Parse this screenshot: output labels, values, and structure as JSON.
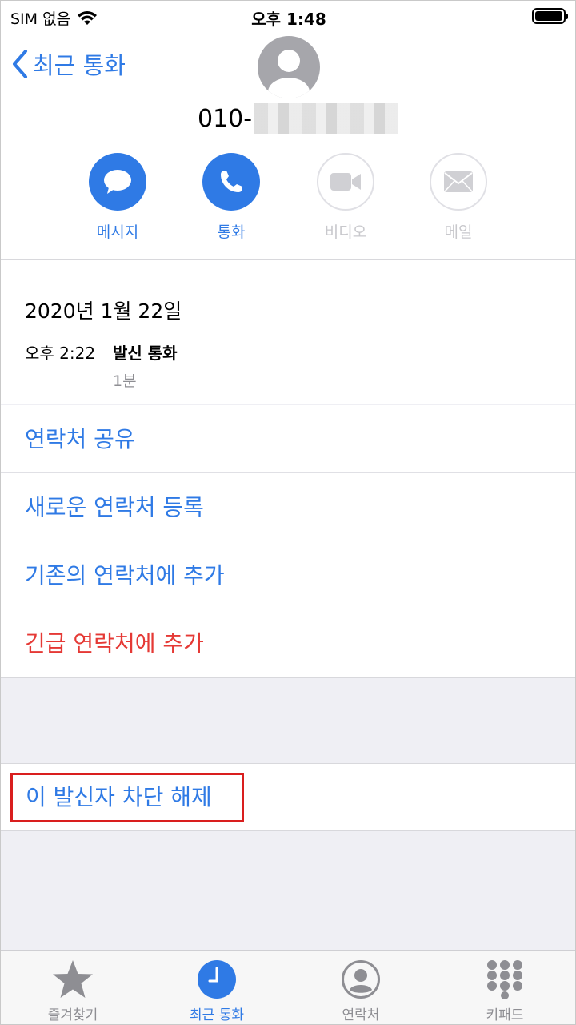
{
  "status_bar": {
    "carrier": "SIM 없음",
    "time": "오후 1:48"
  },
  "nav": {
    "back_label": "최근 통화"
  },
  "contact": {
    "number_prefix": "010-"
  },
  "actions": [
    {
      "label": "메시지",
      "icon": "message-icon",
      "enabled": true
    },
    {
      "label": "통화",
      "icon": "phone-icon",
      "enabled": true
    },
    {
      "label": "비디오",
      "icon": "video-icon",
      "enabled": false
    },
    {
      "label": "메일",
      "icon": "mail-icon",
      "enabled": false
    }
  ],
  "call_log": {
    "date": "2020년 1월 22일",
    "time": "오후 2:22",
    "type": "발신 통화",
    "duration": "1분"
  },
  "menu": [
    {
      "label": "연락처 공유"
    },
    {
      "label": "새로운 연락처 등록"
    },
    {
      "label": "기존의 연락처에 추가"
    },
    {
      "label": "긴급 연락처에 추가"
    }
  ],
  "unblock": {
    "label": "이 발신자 차단 해제"
  },
  "tabs": [
    {
      "label": "즐겨찾기",
      "icon": "star-icon",
      "active": false
    },
    {
      "label": "최근 통화",
      "icon": "clock-icon",
      "active": true
    },
    {
      "label": "연락처",
      "icon": "contacts-icon",
      "active": false
    },
    {
      "label": "키패드",
      "icon": "keypad-icon",
      "active": false
    }
  ],
  "colors": {
    "accent": "#2f7ae5",
    "destructive": "#e53935",
    "highlight_box": "#d91e1e",
    "disabled": "#c8c8cc"
  }
}
